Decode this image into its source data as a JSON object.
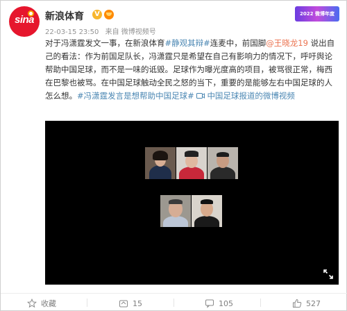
{
  "header": {
    "avatar_text": "sina",
    "account_name": "新浪体育",
    "verify_mark": "V",
    "timestamp": "22-03-15 23:50",
    "source": "来自 微博视频号",
    "banner_text": "2022 微博年度"
  },
  "post": {
    "segments": [
      {
        "type": "text",
        "value": "对于冯潇霆发文一事，在新浪体育"
      },
      {
        "type": "topic",
        "value": "#静观其辩#"
      },
      {
        "type": "text",
        "value": "连麦中，前国脚"
      },
      {
        "type": "mention",
        "value": "@王晓龙19"
      },
      {
        "type": "text",
        "value": " 说出自己的看法：作为前国足队长，冯潇霆只是希望在自己有影响力的情况下，呼吁舆论帮助中国足球，而不是一味的诋毁。足球作为曝光度高的项目，被骂很正常，梅西在巴黎也被骂。在中国足球触动全民之怒的当下，重要的是能够左右中国足球的人怎么想。"
      },
      {
        "type": "topic",
        "value": "#冯潇霆发言是想帮助中国足球#"
      },
      {
        "type": "text",
        "value": " "
      },
      {
        "type": "video_link",
        "value": "中国足球报道的微博视频"
      }
    ]
  },
  "toolbar": {
    "favorite_label": "收藏",
    "repost_count": "15",
    "comment_count": "105",
    "like_count": "527"
  },
  "icons": {
    "favorite": "star-icon",
    "repost": "repost-icon",
    "comment": "comment-icon",
    "like": "thumbs-up-icon",
    "video_link": "video-camera-icon",
    "fullscreen": "fullscreen-icon"
  },
  "colors": {
    "brand_red": "#e6162d",
    "link_blue": "#4b87b3",
    "mention_orange": "#eb7350",
    "meta_gray": "#939393"
  }
}
